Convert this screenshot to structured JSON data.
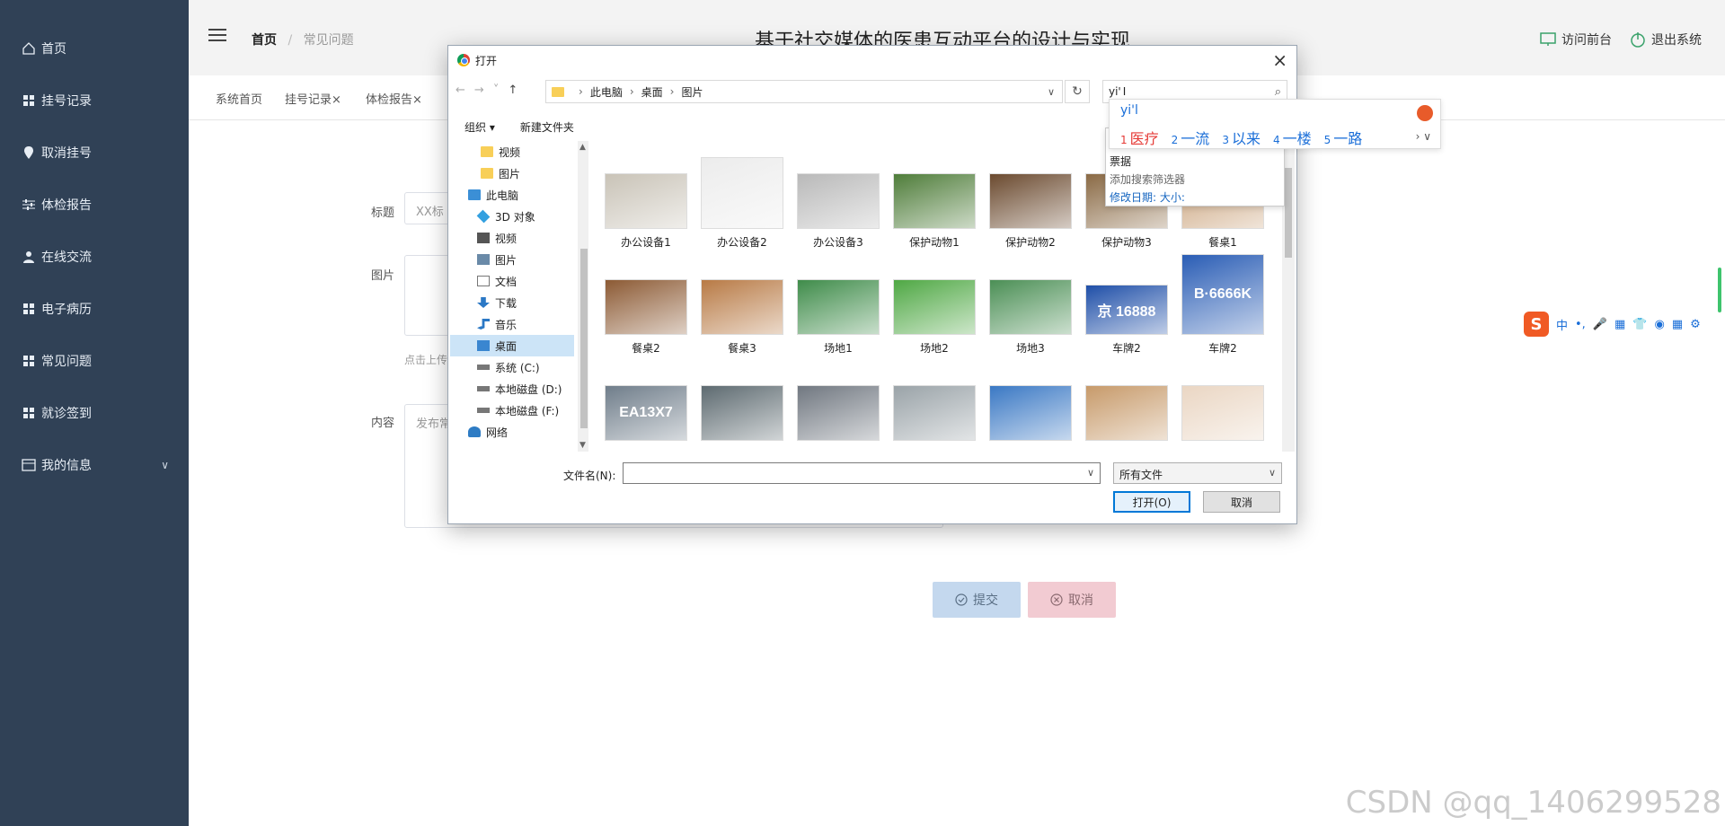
{
  "sidebar": {
    "items": [
      {
        "label": "首页",
        "icon": "home-icon"
      },
      {
        "label": "挂号记录",
        "icon": "grid-icon"
      },
      {
        "label": "取消挂号",
        "icon": "location-icon"
      },
      {
        "label": "体检报告",
        "icon": "sliders-icon"
      },
      {
        "label": "在线交流",
        "icon": "user-icon"
      },
      {
        "label": "电子病历",
        "icon": "grid-icon"
      },
      {
        "label": "常见问题",
        "icon": "grid-icon"
      },
      {
        "label": "就诊签到",
        "icon": "grid-icon"
      },
      {
        "label": "我的信息",
        "icon": "card-icon"
      }
    ],
    "bg_color": "#304156"
  },
  "header": {
    "breadcrumb_home": "首页",
    "breadcrumb_current": "常见问题",
    "site_title": "基于社交媒体的医患互动平台的设计与实现",
    "visit_front": "访问前台",
    "logout": "退出系统"
  },
  "tags": [
    "系统首页",
    "挂号记录",
    "体检报告"
  ],
  "form": {
    "title_label": "标题",
    "title_placeholder": "XX标",
    "image_label": "图片",
    "upload_hint": "点击上传",
    "content_label": "内容",
    "content_placeholder": "发布常",
    "submit": "提交",
    "cancel": "取消"
  },
  "dialog": {
    "title": "打开",
    "path": [
      "此电脑",
      "桌面",
      "图片"
    ],
    "search_value": "yi'",
    "organize": "组织 ▾",
    "new_folder": "新建文件夹",
    "tree": [
      {
        "label": "视频",
        "icon": "folder-icon"
      },
      {
        "label": "图片",
        "icon": "folder-icon"
      },
      {
        "label": "此电脑",
        "icon": "pc-icon"
      },
      {
        "label": "3D 对象",
        "icon": "cube-icon"
      },
      {
        "label": "视频",
        "icon": "video-icon"
      },
      {
        "label": "图片",
        "icon": "picture-icon"
      },
      {
        "label": "文档",
        "icon": "document-icon"
      },
      {
        "label": "下载",
        "icon": "download-icon"
      },
      {
        "label": "音乐",
        "icon": "music-icon"
      },
      {
        "label": "桌面",
        "icon": "desktop-icon",
        "selected": true
      },
      {
        "label": "系统 (C:)",
        "icon": "drive-icon"
      },
      {
        "label": "本地磁盘 (D:)",
        "icon": "drive-icon"
      },
      {
        "label": "本地磁盘 (F:)",
        "icon": "drive-icon"
      },
      {
        "label": "网络",
        "icon": "network-icon"
      }
    ],
    "files": [
      {
        "name": "办公设备1",
        "color": "#c9c3b7"
      },
      {
        "name": "办公设备2",
        "color": "#ececec"
      },
      {
        "name": "办公设备3",
        "color": "#b9b9b9"
      },
      {
        "name": "保护动物1",
        "color": "#4f7d3a"
      },
      {
        "name": "保护动物2",
        "color": "#6b4a2f"
      },
      {
        "name": "保护动物3",
        "color": "#8a6a45"
      },
      {
        "name": "餐桌1",
        "color": "#caa27a"
      },
      {
        "name": "餐桌2",
        "color": "#8c5a34"
      },
      {
        "name": "餐桌3",
        "color": "#b87a45"
      },
      {
        "name": "场地1",
        "color": "#3f8c4a"
      },
      {
        "name": "场地2",
        "color": "#4fa844"
      },
      {
        "name": "场地3",
        "color": "#4b8f55"
      },
      {
        "name": "车牌2",
        "color": "#1f4fa8",
        "plate": "京 16888"
      },
      {
        "name": "车牌2",
        "color": "#2a5db5",
        "plate": "B·6666K"
      },
      {
        "name": "",
        "color": "#6f7d8a",
        "plate": "EA13X7"
      },
      {
        "name": "",
        "color": "#5d6a70"
      },
      {
        "name": "",
        "color": "#707780"
      },
      {
        "name": "",
        "color": "#9aa3a8"
      },
      {
        "name": "",
        "color": "#3a78c4"
      },
      {
        "name": "",
        "color": "#c79a6a"
      },
      {
        "name": "",
        "color": "#ead6c3"
      }
    ],
    "filename_label": "文件名(N):",
    "filetype": "所有文件",
    "open_button": "打开(O)",
    "cancel_button": "取消"
  },
  "search_suggest": {
    "line1": "票据",
    "line2": "添加搜索筛选器",
    "line3": "修改日期:   大小:"
  },
  "ime": {
    "composition": "yi'l",
    "candidates": [
      {
        "num": "1",
        "text": "医疗"
      },
      {
        "num": "2",
        "text": "一流"
      },
      {
        "num": "3",
        "text": "以来"
      },
      {
        "num": "4",
        "text": "一楼"
      },
      {
        "num": "5",
        "text": "一路"
      }
    ],
    "toolbar": [
      "中",
      "•,",
      "🎤",
      "▦",
      "👕",
      "◉",
      "▦",
      "⚙"
    ]
  },
  "watermark": "CSDN @qq_1406299528"
}
